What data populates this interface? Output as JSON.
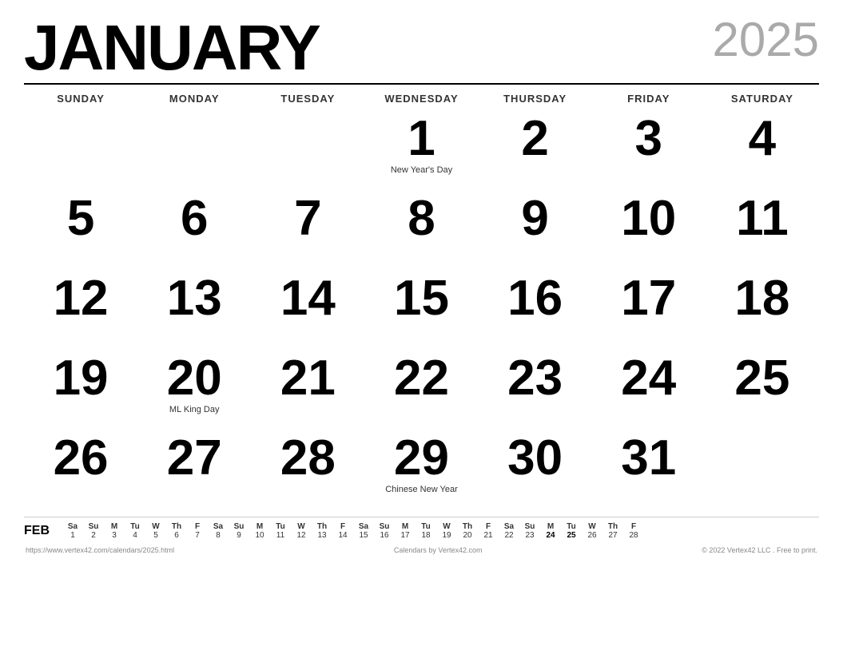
{
  "header": {
    "month": "JANUARY",
    "year": "2025"
  },
  "dayHeaders": [
    "SUNDAY",
    "MONDAY",
    "TUESDAY",
    "WEDNESDAY",
    "THURSDAY",
    "FRIDAY",
    "SATURDAY"
  ],
  "weeks": [
    [
      {
        "day": "",
        "holiday": ""
      },
      {
        "day": "",
        "holiday": ""
      },
      {
        "day": "",
        "holiday": ""
      },
      {
        "day": "1",
        "holiday": "New Year's Day"
      },
      {
        "day": "2",
        "holiday": ""
      },
      {
        "day": "3",
        "holiday": ""
      },
      {
        "day": "4",
        "holiday": ""
      }
    ],
    [
      {
        "day": "5",
        "holiday": ""
      },
      {
        "day": "6",
        "holiday": ""
      },
      {
        "day": "7",
        "holiday": ""
      },
      {
        "day": "8",
        "holiday": ""
      },
      {
        "day": "9",
        "holiday": ""
      },
      {
        "day": "10",
        "holiday": ""
      },
      {
        "day": "11",
        "holiday": ""
      }
    ],
    [
      {
        "day": "12",
        "holiday": ""
      },
      {
        "day": "13",
        "holiday": ""
      },
      {
        "day": "14",
        "holiday": ""
      },
      {
        "day": "15",
        "holiday": ""
      },
      {
        "day": "16",
        "holiday": ""
      },
      {
        "day": "17",
        "holiday": ""
      },
      {
        "day": "18",
        "holiday": ""
      }
    ],
    [
      {
        "day": "19",
        "holiday": ""
      },
      {
        "day": "20",
        "holiday": "ML King Day"
      },
      {
        "day": "21",
        "holiday": ""
      },
      {
        "day": "22",
        "holiday": ""
      },
      {
        "day": "23",
        "holiday": ""
      },
      {
        "day": "24",
        "holiday": ""
      },
      {
        "day": "25",
        "holiday": ""
      }
    ],
    [
      {
        "day": "26",
        "holiday": ""
      },
      {
        "day": "27",
        "holiday": ""
      },
      {
        "day": "28",
        "holiday": ""
      },
      {
        "day": "29",
        "holiday": "Chinese New Year"
      },
      {
        "day": "30",
        "holiday": ""
      },
      {
        "day": "31",
        "holiday": ""
      },
      {
        "day": "",
        "holiday": ""
      }
    ]
  ],
  "miniCal": {
    "label": "FEB",
    "headers": [
      "Sa",
      "Su",
      "M",
      "Tu",
      "W",
      "Th",
      "F",
      "Sa",
      "Su",
      "M",
      "Tu",
      "W",
      "Th",
      "F",
      "Sa",
      "Su",
      "M",
      "Tu",
      "W",
      "Th",
      "F",
      "Sa",
      "Su",
      "M",
      "Tu",
      "W",
      "Th",
      "F"
    ],
    "numbers": [
      "1",
      "2",
      "3",
      "4",
      "5",
      "6",
      "7",
      "8",
      "9",
      "10",
      "11",
      "12",
      "13",
      "14",
      "15",
      "16",
      "17",
      "18",
      "19",
      "20",
      "21",
      "22",
      "23",
      "24",
      "25",
      "26",
      "27",
      "28"
    ],
    "boldDays": [
      "24",
      "25"
    ]
  },
  "footer": {
    "url": "https://www.vertex42.com/calendars/2025.html",
    "center": "Calendars by Vertex42.com",
    "right": "© 2022 Vertex42 LLC . Free to print."
  }
}
